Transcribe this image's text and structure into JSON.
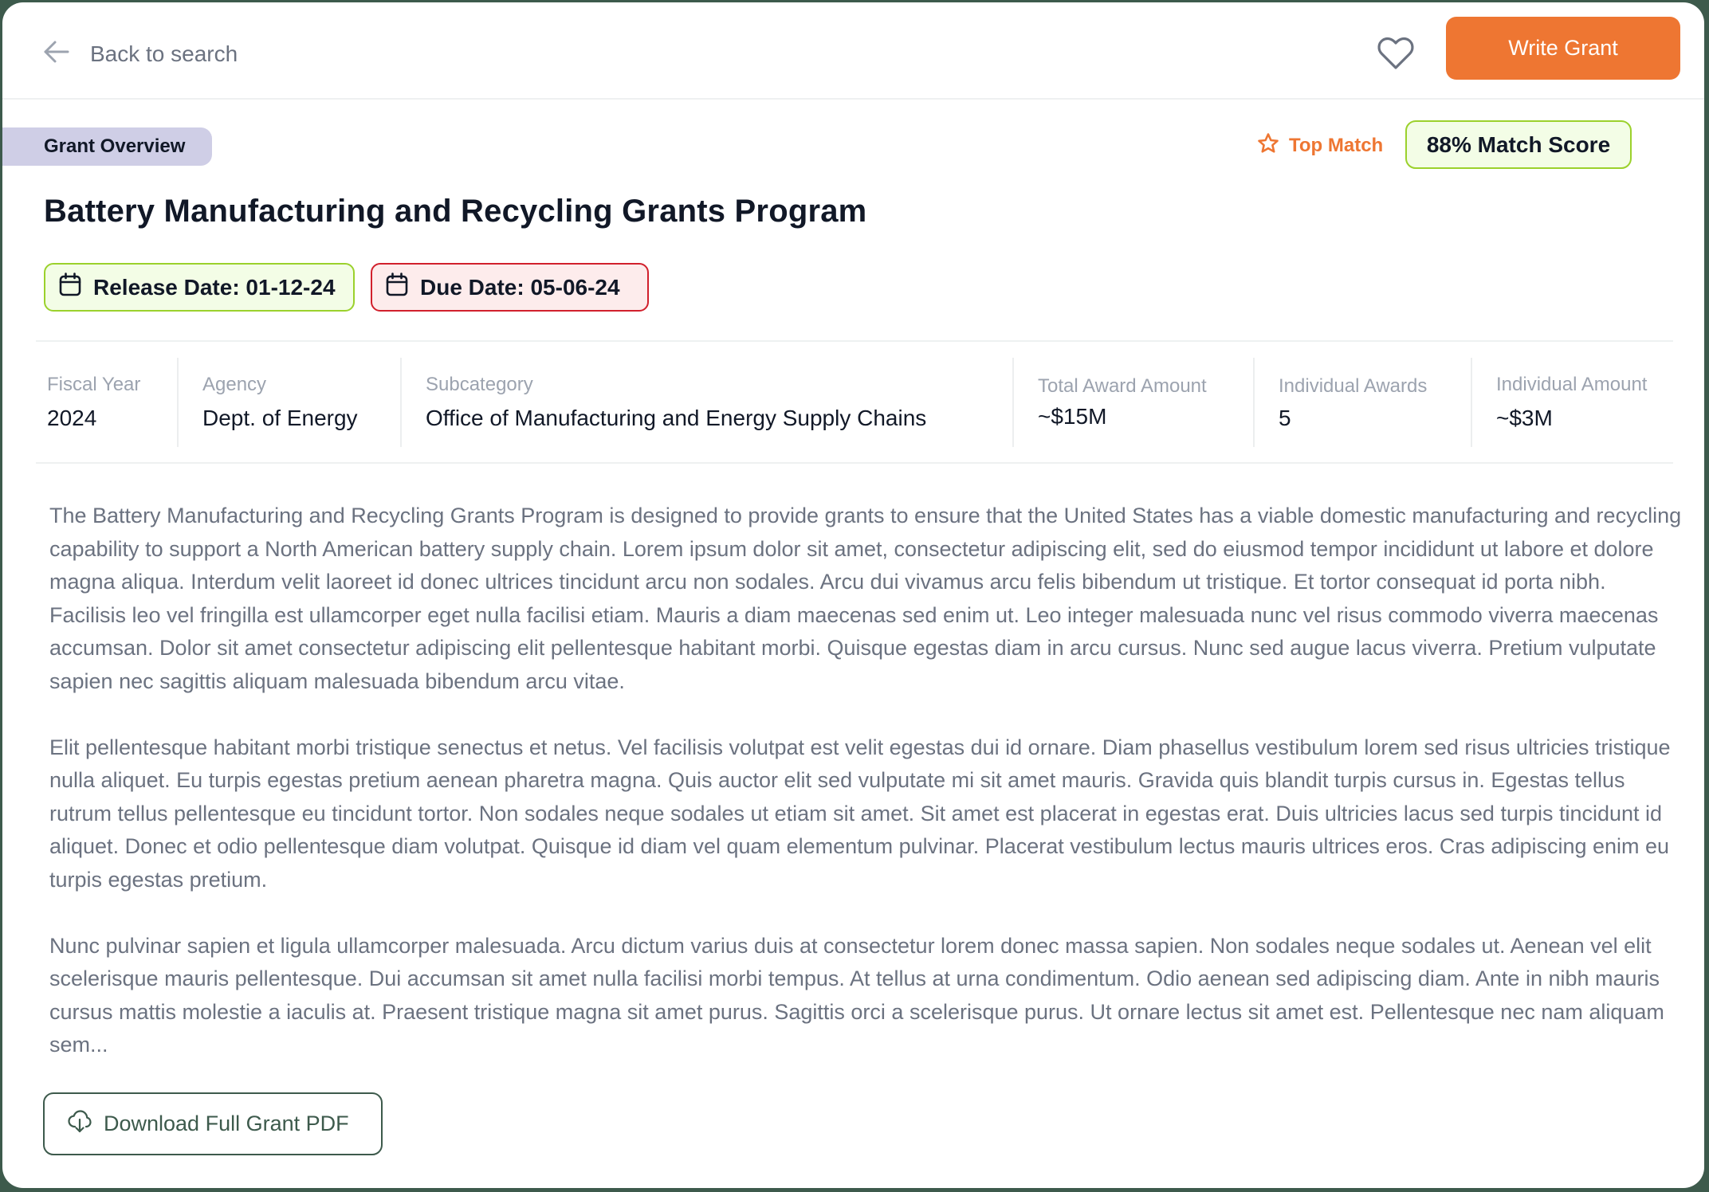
{
  "header": {
    "back_label": "Back to search",
    "write_grant_label": "Write Grant",
    "favorite_icon": "heart-outline-icon"
  },
  "badges": {
    "section_tag": "Grant Overview",
    "top_match_label": "Top Match",
    "match_score": "88% Match Score",
    "match_score_value": 88
  },
  "grant": {
    "title": "Battery Manufacturing and Recycling Grants Program",
    "release_date": "Release Date: 01-12-24",
    "due_date": "Due Date: 05-06-24"
  },
  "info": [
    {
      "label": "Fiscal Year",
      "value": "2024"
    },
    {
      "label": "Agency",
      "value": "Dept. of Energy"
    },
    {
      "label": "Subcategory",
      "value": "Office of Manufacturing and Energy Supply Chains"
    },
    {
      "label": "Total Award Amount",
      "value": "~$15M"
    },
    {
      "label": "Individual Awards",
      "value": "5"
    },
    {
      "label": "Individual Amount",
      "value": "~$3M"
    }
  ],
  "description": [
    "The Battery Manufacturing and Recycling Grants Program is designed to provide grants to ensure that the United States has a viable domestic manufacturing and recycling capability to support a North American battery supply chain. Lorem ipsum dolor sit amet, consectetur adipiscing elit, sed do eiusmod tempor incididunt ut labore et dolore magna aliqua. Interdum velit laoreet id donec ultrices tincidunt arcu non sodales. Arcu dui vivamus arcu felis bibendum ut tristique. Et tortor consequat id porta nibh. Facilisis leo vel fringilla est ullamcorper eget nulla facilisi etiam. Mauris a diam maecenas sed enim ut. Leo integer malesuada nunc vel risus commodo viverra maecenas accumsan. Dolor sit amet consectetur adipiscing elit pellentesque habitant morbi. Quisque egestas diam in arcu cursus. Nunc sed augue lacus viverra. Pretium vulputate sapien nec sagittis aliquam malesuada bibendum arcu vitae.",
    "Elit pellentesque habitant morbi tristique senectus et netus. Vel facilisis volutpat est velit egestas dui id ornare. Diam phasellus vestibulum lorem sed risus ultricies tristique nulla aliquet. Eu turpis egestas pretium aenean pharetra magna. Quis auctor elit sed vulputate mi sit amet mauris. Gravida quis blandit turpis cursus in. Egestas tellus rutrum tellus pellentesque eu tincidunt tortor. Non sodales neque sodales ut etiam sit amet. Sit amet est placerat in egestas erat. Duis ultricies lacus sed turpis tincidunt id aliquet. Donec et odio pellentesque diam volutpat. Quisque id diam vel quam elementum pulvinar. Placerat vestibulum lectus mauris ultrices eros. Cras adipiscing enim eu turpis egestas pretium.",
    "Nunc pulvinar sapien et ligula ullamcorper malesuada. Arcu dictum varius duis at consectetur lorem donec massa sapien. Non sodales neque sodales ut. Aenean vel elit scelerisque mauris pellentesque. Dui accumsan sit amet nulla facilisi morbi tempus. At tellus at urna condimentum. Odio aenean sed adipiscing diam. Ante in nibh mauris cursus mattis molestie a iaculis at. Praesent tristique magna sit amet purus. Sagittis orci a scelerisque purus. Ut ornare lectus sit amet est. Pellentesque nec nam aliquam sem..."
  ],
  "download_label": "Download Full Grant PDF",
  "colors": {
    "frame": "#3d5a4c",
    "accent_orange": "#ee7632",
    "match_green_border": "#9bd12c",
    "match_green_bg": "#f3fde6",
    "due_red_border": "#d1202c",
    "due_red_bg": "#fdecec",
    "tag_lavender": "#cfcee6",
    "muted_text": "#6b7280"
  }
}
